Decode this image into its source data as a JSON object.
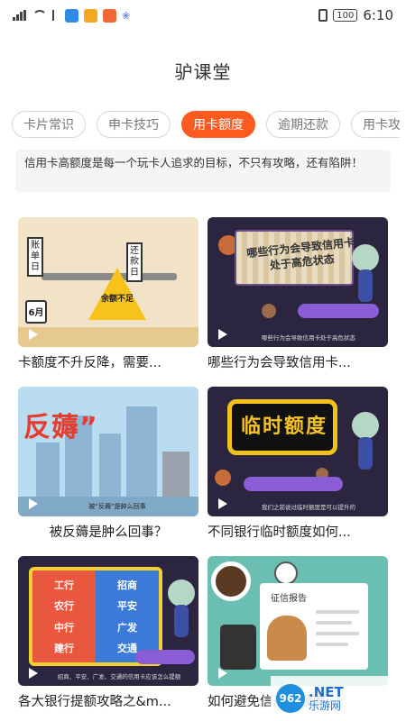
{
  "status_bar": {
    "time": "6:10",
    "battery": "100",
    "app_icon_colors": [
      "#2f8be6",
      "#f5a623",
      "#f06a35"
    ]
  },
  "header": {
    "title": "驴课堂"
  },
  "tabs": [
    {
      "label": "卡片常识",
      "active": false
    },
    {
      "label": "申卡技巧",
      "active": false
    },
    {
      "label": "用卡额度",
      "active": true
    },
    {
      "label": "逾期还款",
      "active": false
    },
    {
      "label": "用卡攻略",
      "active": false
    }
  ],
  "intro": {
    "text": "信用卡高额度是每一个玩卡人追求的目标，不只有攻略，还有陷阱！"
  },
  "cards": [
    {
      "title": "卡额度不升反降，需要...",
      "thumb": {
        "tag_left": "账单日",
        "tag_right": "还款日",
        "warning": "余额不足",
        "calendar": "6月"
      }
    },
    {
      "title": "哪些行为会导致信用卡...",
      "thumb": {
        "board_text": "哪些行为会导致信用卡处于高危状态",
        "subtitle": "哪些行为会导致信用卡处于高危状态"
      }
    },
    {
      "title": "被反薅是肿么回事？",
      "thumb": {
        "big_text": "反薅”",
        "caption": "被“反薅”是肿么回事"
      }
    },
    {
      "title": "不同银行临时额度如何...",
      "thumb": {
        "board_text": "临时额度",
        "subtitle": "我们之前说过临时额度是可以提升的"
      }
    },
    {
      "title": "各大银行提额攻略之&m...",
      "thumb": {
        "banks_left": [
          "工行",
          "农行",
          "中行",
          "建行"
        ],
        "banks_right": [
          "招商",
          "平安",
          "广发",
          "交通"
        ],
        "subtitle": "招商、平安、广发、交通的信用卡应该怎么提额"
      }
    },
    {
      "title": "如何避免信用卡额度...",
      "thumb": {
        "doc_title": "征信报告"
      }
    }
  ],
  "watermark": {
    "logo": "962",
    "net": ".NET",
    "cn": "乐游网"
  }
}
